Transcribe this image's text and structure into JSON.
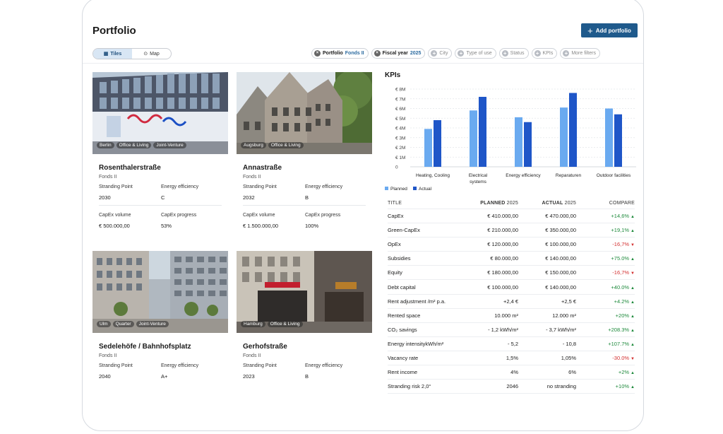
{
  "header": {
    "title": "Portfolio",
    "add_button": "Add portfolio"
  },
  "view_toggle": {
    "tiles": "Tiles",
    "map": "Map"
  },
  "filters": [
    {
      "label": "Portfolio",
      "value": "Fonds II",
      "active": true
    },
    {
      "label": "Fiscal year",
      "value": "2025",
      "active": true
    },
    {
      "label": "City",
      "value": "",
      "active": false
    },
    {
      "label": "Type of use",
      "value": "",
      "active": false
    },
    {
      "label": "Status",
      "value": "",
      "active": false
    },
    {
      "label": "KPIs",
      "value": "",
      "active": false
    },
    {
      "label": "More filters",
      "value": "",
      "active": false
    }
  ],
  "properties": [
    {
      "name": "Rosenthalerstraße",
      "fund": "Fonds II",
      "tags": [
        "Berlin",
        "Office & Living",
        "Joint-Venture"
      ],
      "stranding_label": "Stranding Point",
      "stranding": "2030",
      "efficiency_label": "Energy efficiency",
      "efficiency": "C",
      "capex_label": "CapEx volume",
      "capex": "€ 500.000,00",
      "progress_label": "CapEx progress",
      "progress": "53%"
    },
    {
      "name": "Annastraße",
      "fund": "Fonds II",
      "tags": [
        "Augsburg",
        "Office & Living"
      ],
      "stranding_label": "Stranding Point",
      "stranding": "2032",
      "efficiency_label": "Energy efficiency",
      "efficiency": "B",
      "capex_label": "CapEx volume",
      "capex": "€ 1.500.000,00",
      "progress_label": "CapEx progress",
      "progress": "100%"
    },
    {
      "name": "Sedelehöfe / Bahnhofsplatz",
      "fund": "Fonds II",
      "tags": [
        "Ulm",
        "Quarter",
        "Joint-Venture"
      ],
      "stranding_label": "Stranding Point",
      "stranding": "2040",
      "efficiency_label": "Energy efficiency",
      "efficiency": "A+"
    },
    {
      "name": "Gerhofstraße",
      "fund": "Fonds II",
      "tags": [
        "Hamburg",
        "Office & Living"
      ],
      "stranding_label": "Stranding Point",
      "stranding": "2023",
      "efficiency_label": "Energy efficiency",
      "efficiency": "B"
    }
  ],
  "kpis": {
    "title": "KPIs",
    "chart_data": {
      "type": "bar",
      "categories": [
        "Heating, Cooling",
        "Electrical systems",
        "Energy efficiency",
        "Reparaturen",
        "Outdoor facilities"
      ],
      "series": [
        {
          "name": "Planned",
          "values": [
            3.9,
            5.8,
            5.1,
            6.1,
            6.0
          ],
          "color": "#6aaaf0"
        },
        {
          "name": "Actual",
          "values": [
            4.8,
            7.2,
            4.6,
            7.6,
            5.4
          ],
          "color": "#1f56c8"
        }
      ],
      "yticks": [
        "€ 8M",
        "€ 7M",
        "€ 6M",
        "€ 5M",
        "€ 4M",
        "€ 3M",
        "€ 2M",
        "€ 1M",
        "0"
      ],
      "ylim": [
        0,
        8
      ],
      "legend": "bottom-left"
    },
    "table": {
      "headers": {
        "title": "TITLE",
        "planned": "PLANNED",
        "planned_year": "2025",
        "actual": "ACTUAL",
        "actual_year": "2025",
        "compare": "COMPARE"
      },
      "rows": [
        {
          "title": "CapEx",
          "planned": "€ 410.000,00",
          "actual": "€ 470.000,00",
          "compare": "+14,6%",
          "dir": "up"
        },
        {
          "title": "Green-CapEx",
          "planned": "€ 210.000,00",
          "actual": "€ 350.000,00",
          "compare": "+19,1%",
          "dir": "up"
        },
        {
          "title": "OpEx",
          "planned": "€ 120.000,00",
          "actual": "€ 100.000,00",
          "compare": "-16,7%",
          "dir": "down"
        },
        {
          "title": "Subsidies",
          "planned": "€ 80.000,00",
          "actual": "€ 140.000,00",
          "compare": "+75.0%",
          "dir": "up"
        },
        {
          "title": "Equity",
          "planned": "€ 180.000,00",
          "actual": "€ 150.000,00",
          "compare": "-16,7%",
          "dir": "down"
        },
        {
          "title": "Debt capital",
          "planned": "€ 100.000,00",
          "actual": "€ 140.000,00",
          "compare": "+40.0%",
          "dir": "up"
        },
        {
          "title": "Rent adjustment /m² p.a.",
          "planned": "+2,4 €",
          "actual": "+2,5 €",
          "compare": "+4.2%",
          "dir": "up"
        },
        {
          "title": "Rented space",
          "planned": "10.000 m²",
          "actual": "12.000 m²",
          "compare": "+20%",
          "dir": "up"
        },
        {
          "title": "CO₂ savings",
          "planned": "- 1,2 kWh/m²",
          "actual": "- 3,7 kWh/m²",
          "compare": "+208.3%",
          "dir": "up"
        },
        {
          "title": "Energy intensitykWh/m²",
          "planned": "- 5,2",
          "actual": "- 10,8",
          "compare": "+107.7%",
          "dir": "up"
        },
        {
          "title": "Vacancy rate",
          "planned": "1,5%",
          "actual": "1,05%",
          "compare": "-30.0%",
          "dir": "down"
        },
        {
          "title": "Rent income",
          "planned": "4%",
          "actual": "6%",
          "compare": "+2%",
          "dir": "up"
        },
        {
          "title": "Stranding risk 2,0°",
          "planned": "2046",
          "actual": "no stranding",
          "compare": "+10%",
          "dir": "up"
        }
      ]
    }
  }
}
